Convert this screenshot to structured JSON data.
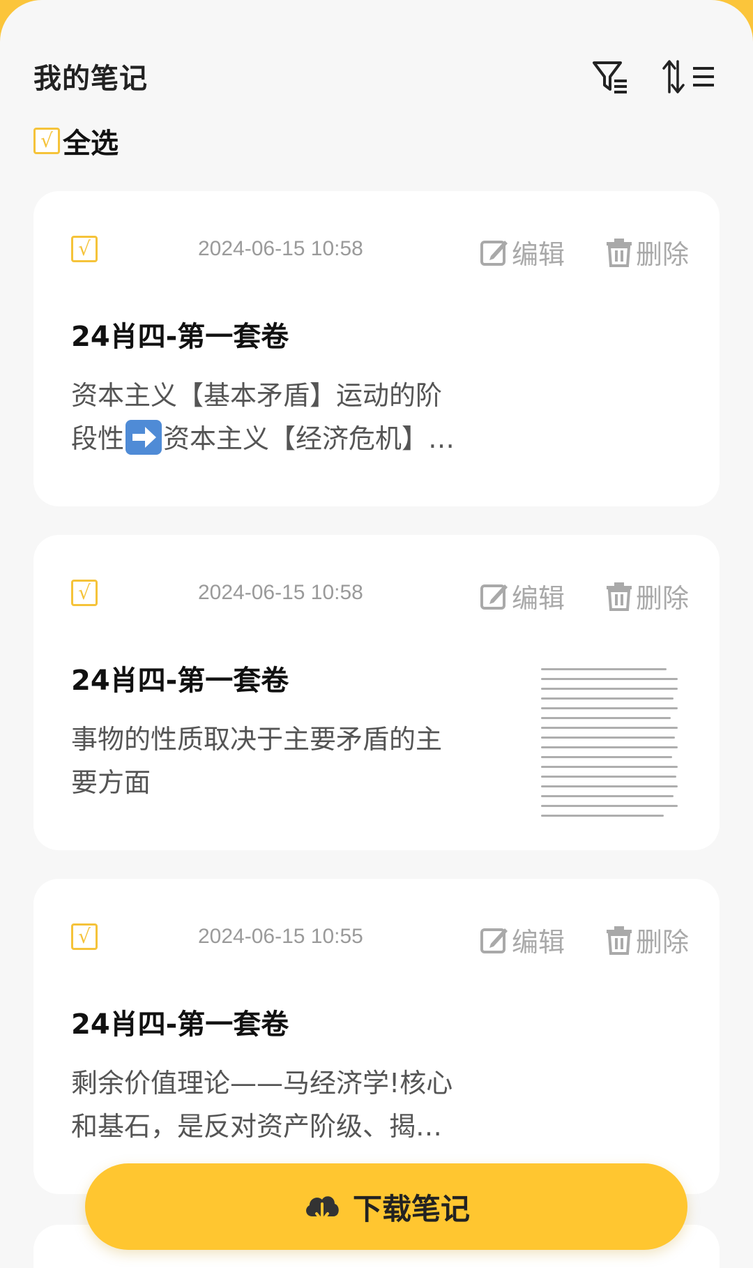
{
  "header": {
    "title": "我的笔记"
  },
  "select_all": {
    "check_mark": "√",
    "label": "全选"
  },
  "actions": {
    "edit_label": "编辑",
    "delete_label": "删除"
  },
  "notes": [
    {
      "check_mark": "√",
      "datetime": "2024-06-15 10:58",
      "title": "24肖四-第一套卷",
      "body_line1": "资本主义【基本矛盾】运动的阶",
      "body_line2_pre": "段性",
      "body_line2_post": "资本主义【经济危机】…",
      "has_image": false
    },
    {
      "check_mark": "√",
      "datetime": "2024-06-15 10:58",
      "title": "24肖四-第一套卷",
      "body_line1": "事物的性质取决于主要矛盾的主",
      "body_line2": "要方面",
      "has_image": true
    },
    {
      "check_mark": "√",
      "datetime": "2024-06-15 10:55",
      "title": "24肖四-第一套卷",
      "body_line1": "剩余价值理论——马经济学!核心",
      "body_line2": "和基石，是反对资产阶级、揭…",
      "has_image": false
    }
  ],
  "download": {
    "label": "下载笔记"
  },
  "colors": {
    "accent": "#FFC630",
    "check": "#F5C33A",
    "muted": "#A9A9A9"
  },
  "icons": {
    "filter": "filter-list-icon",
    "sort": "sort-arrows-icon",
    "edit": "edit-icon",
    "delete": "trash-icon",
    "download": "cloud-download-icon"
  }
}
